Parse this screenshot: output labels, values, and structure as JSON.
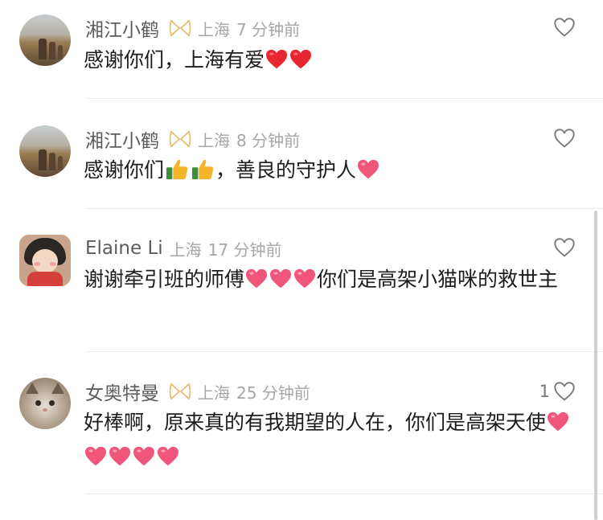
{
  "comments": [
    {
      "username": "湘江小鹤",
      "location": "上海",
      "time": "7 分钟前",
      "text": "感谢你们，上海有爱",
      "emojis": [
        "red-heart",
        "red-heart"
      ],
      "likes": ""
    },
    {
      "username": "湘江小鹤",
      "location": "上海",
      "time": "8 分钟前",
      "text_a": "感谢你们",
      "text_b": "，善良的守护人",
      "emojis": [
        "thumbs-up",
        "thumbs-up",
        "pink-heart"
      ],
      "likes": ""
    },
    {
      "username": "Elaine Li",
      "location": "上海",
      "time": "17 分钟前",
      "text_a": "谢谢牵引班的师傅",
      "text_b": "你们是高架小猫咪的救世主",
      "emojis": [
        "pink-heart",
        "pink-heart",
        "pink-heart"
      ],
      "likes": ""
    },
    {
      "username": "女奥特曼",
      "location": "上海",
      "time": "25 分钟前",
      "text": "好棒啊，原来真的有我期望的人在，你们是高架天使",
      "emojis": [
        "pink-heart",
        "pink-heart",
        "pink-heart",
        "pink-heart",
        "pink-heart"
      ],
      "likes": "1"
    }
  ],
  "icons": {
    "like": "heart-outline-icon",
    "badge": "ribbon-badge-icon"
  },
  "colors": {
    "username": "#5c5c5c",
    "meta": "#a6a6a6",
    "red_heart": "#e8262f",
    "pink_heart": "#f0557a",
    "thumb": "#f5b52a"
  }
}
